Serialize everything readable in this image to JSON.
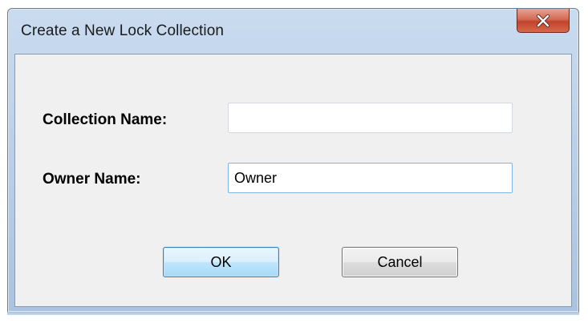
{
  "window": {
    "title": "Create a New Lock Collection",
    "close_icon": "close-x-icon",
    "close_color": "#c8452c"
  },
  "form": {
    "collection_name_label": "Collection Name:",
    "collection_name_value": "",
    "owner_name_label": "Owner Name:",
    "owner_name_value": "Owner"
  },
  "buttons": {
    "ok_label": "OK",
    "cancel_label": "Cancel"
  }
}
